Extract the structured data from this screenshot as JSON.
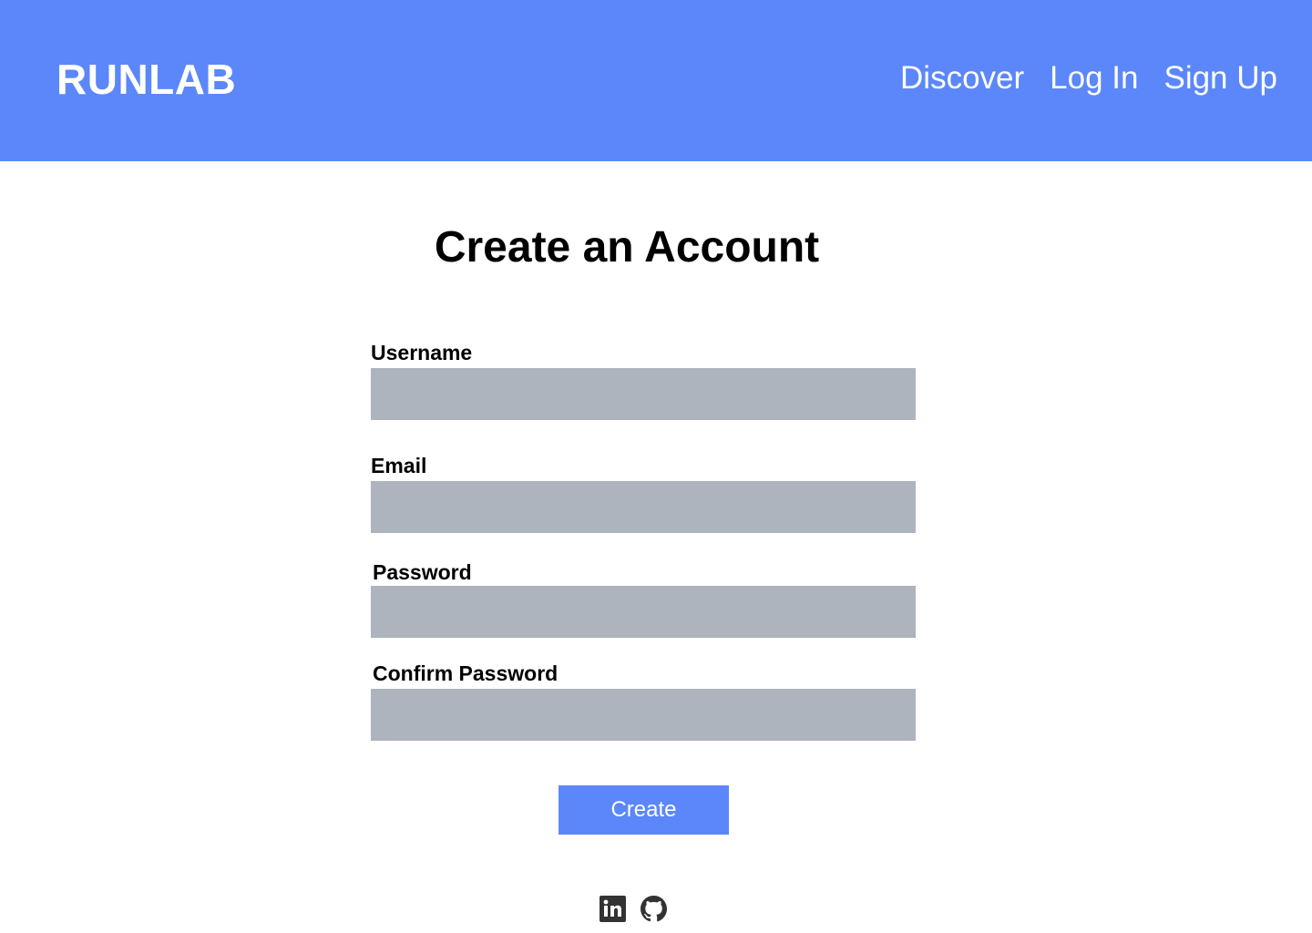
{
  "header": {
    "brand": "RUNLAB",
    "nav": [
      "Discover",
      "Log In",
      "Sign Up"
    ],
    "background_color": "#5b87fa"
  },
  "form": {
    "title": "Create an Account",
    "fields": [
      {
        "label": "Username",
        "value": "",
        "placeholder": ""
      },
      {
        "label": "Email",
        "value": "",
        "placeholder": ""
      },
      {
        "label": "Password",
        "value": "",
        "placeholder": ""
      },
      {
        "label": "Confirm Password",
        "value": "",
        "placeholder": ""
      }
    ],
    "input_color": "#adb4bd",
    "submit_label": "Create"
  },
  "footer": {
    "icons": [
      "linkedin-icon",
      "github-icon"
    ]
  }
}
